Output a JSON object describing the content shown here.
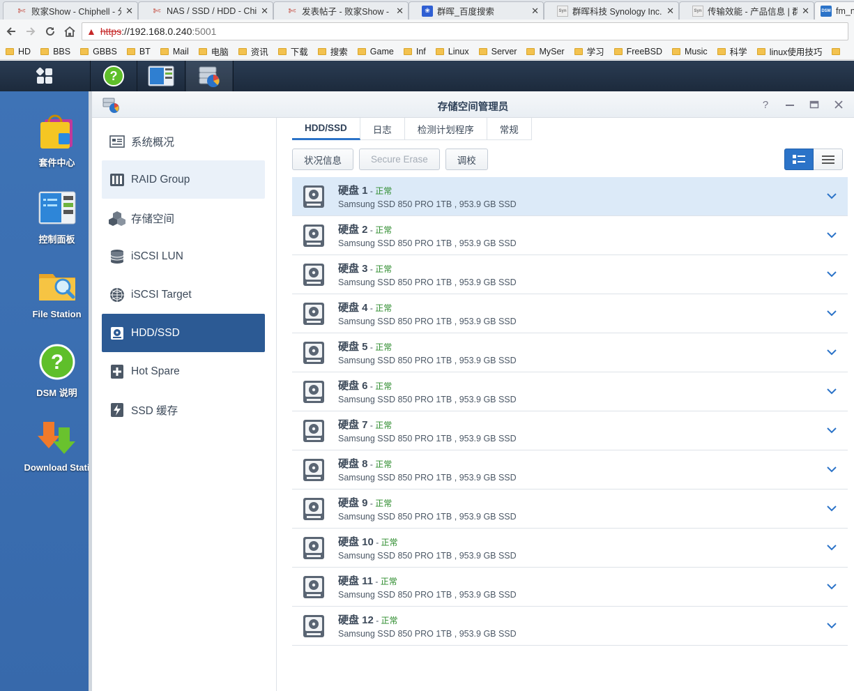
{
  "browser": {
    "tabs": [
      {
        "title": "败家Show - Chiphell - 分",
        "icon": "chiphell-icon"
      },
      {
        "title": "NAS / SSD / HDD - Chiph",
        "icon": "chiphell-icon"
      },
      {
        "title": "发表帖子 - 败家Show - C",
        "icon": "chiphell-icon"
      },
      {
        "title": "群晖_百度搜索",
        "icon": "baidu-paw-icon"
      },
      {
        "title": "群晖科技 Synology Inc.",
        "icon": "synology-icon"
      },
      {
        "title": "传输效能 - 产品信息 | 群",
        "icon": "synology-icon"
      },
      {
        "title": "fm_n",
        "icon": "dsm-icon"
      }
    ],
    "url": {
      "scheme": "https",
      "host": "://192.168.0.240",
      "port": ":5001"
    },
    "bookmarks": [
      "HD",
      "BBS",
      "GBBS",
      "BT",
      "Mail",
      "电脑",
      "资讯",
      "下载",
      "搜索",
      "Game",
      "Inf",
      "Linux",
      "Server",
      "MySer",
      "学习",
      "FreeBSD",
      "Music",
      "科学",
      "linux使用技巧"
    ]
  },
  "desktop": {
    "icons": [
      {
        "label": "套件中心",
        "icon": "package-center-icon"
      },
      {
        "label": "控制面板",
        "icon": "control-panel-icon"
      },
      {
        "label": "File Station",
        "icon": "file-station-icon"
      },
      {
        "label": "DSM 说明",
        "icon": "dsm-help-icon"
      },
      {
        "label": "Download Stati",
        "icon": "download-station-icon"
      }
    ]
  },
  "window": {
    "title": "存储空间管理员",
    "sidebar": [
      {
        "label": "系统概况",
        "icon": "overview-icon"
      },
      {
        "label": "RAID Group",
        "icon": "raid-group-icon"
      },
      {
        "label": "存储空间",
        "icon": "volume-icon"
      },
      {
        "label": "iSCSI LUN",
        "icon": "iscsi-lun-icon"
      },
      {
        "label": "iSCSI Target",
        "icon": "iscsi-target-icon"
      },
      {
        "label": "HDD/SSD",
        "icon": "hdd-ssd-icon"
      },
      {
        "label": "Hot Spare",
        "icon": "hot-spare-icon"
      },
      {
        "label": "SSD 缓存",
        "icon": "ssd-cache-icon"
      }
    ],
    "tabs": [
      "HDD/SSD",
      "日志",
      "检测计划程序",
      "常规"
    ],
    "actions": {
      "status": "状况信息",
      "secure_erase": "Secure Erase",
      "calibrate": "调校"
    },
    "disks": [
      {
        "name": "硬盘 1",
        "status": "正常",
        "desc": "Samsung SSD 850 PRO 1TB , 953.9 GB SSD"
      },
      {
        "name": "硬盘 2",
        "status": "正常",
        "desc": "Samsung SSD 850 PRO 1TB , 953.9 GB SSD"
      },
      {
        "name": "硬盘 3",
        "status": "正常",
        "desc": "Samsung SSD 850 PRO 1TB , 953.9 GB SSD"
      },
      {
        "name": "硬盘 4",
        "status": "正常",
        "desc": "Samsung SSD 850 PRO 1TB , 953.9 GB SSD"
      },
      {
        "name": "硬盘 5",
        "status": "正常",
        "desc": "Samsung SSD 850 PRO 1TB , 953.9 GB SSD"
      },
      {
        "name": "硬盘 6",
        "status": "正常",
        "desc": "Samsung SSD 850 PRO 1TB , 953.9 GB SSD"
      },
      {
        "name": "硬盘 7",
        "status": "正常",
        "desc": "Samsung SSD 850 PRO 1TB , 953.9 GB SSD"
      },
      {
        "name": "硬盘 8",
        "status": "正常",
        "desc": "Samsung SSD 850 PRO 1TB , 953.9 GB SSD"
      },
      {
        "name": "硬盘 9",
        "status": "正常",
        "desc": "Samsung SSD 850 PRO 1TB , 953.9 GB SSD"
      },
      {
        "name": "硬盘 10",
        "status": "正常",
        "desc": "Samsung SSD 850 PRO 1TB , 953.9 GB SSD"
      },
      {
        "name": "硬盘 11",
        "status": "正常",
        "desc": "Samsung SSD 850 PRO 1TB , 953.9 GB SSD"
      },
      {
        "name": "硬盘 12",
        "status": "正常",
        "desc": "Samsung SSD 850 PRO 1TB , 953.9 GB SSD"
      }
    ]
  },
  "colors": {
    "accent": "#2b73c8",
    "selected": "#2c5a94",
    "status_ok": "#2a8a2a",
    "desktop": "#3e73b6",
    "taskbar": "#1c2a3c"
  }
}
